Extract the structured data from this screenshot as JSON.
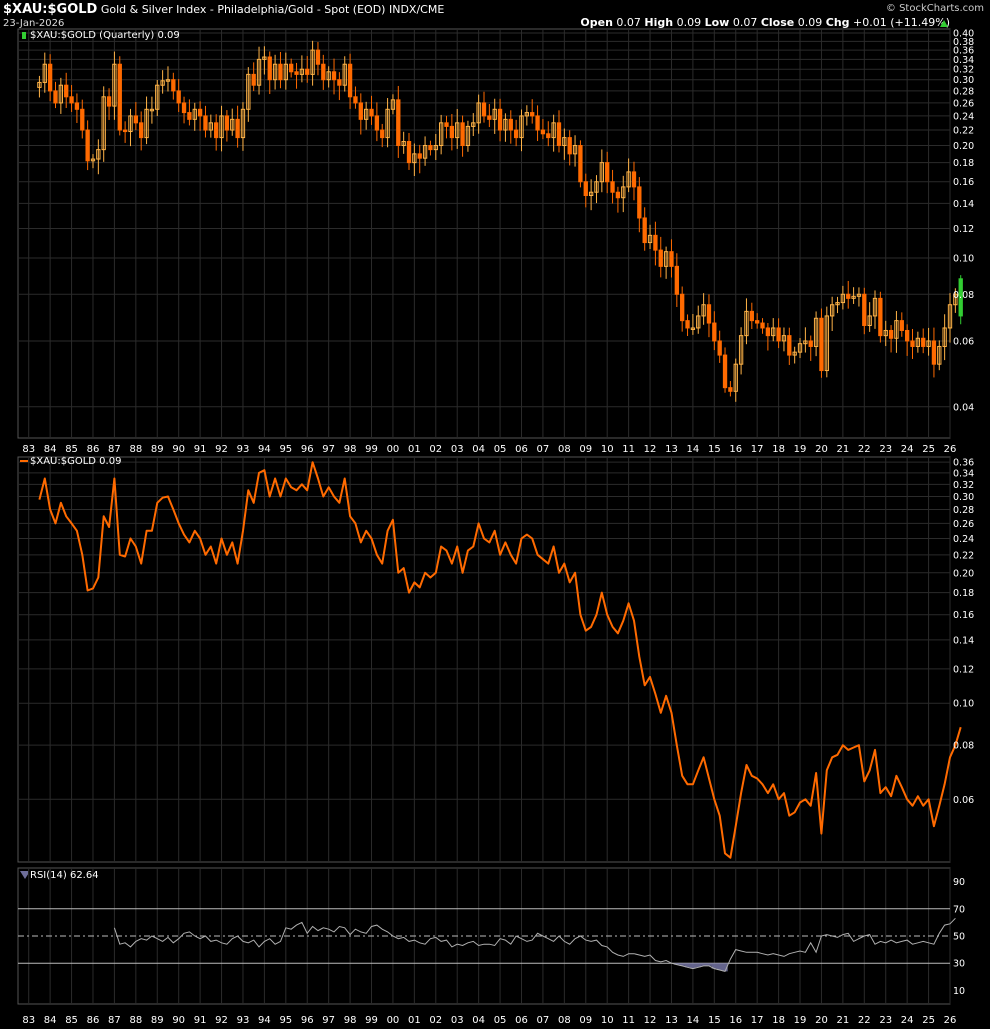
{
  "header": {
    "symbol": "$XAU:$GOLD",
    "description": "Gold & Silver Index - Philadelphia/Gold - Spot (EOD)",
    "exchange": "INDX/CME",
    "date": "23-Jan-2026",
    "brand": "© StockCharts.com",
    "open_label": "Open",
    "open": "0.07",
    "high_label": "High",
    "high": "0.09",
    "low_label": "Low",
    "low": "0.07",
    "close_label": "Close",
    "close": "0.09",
    "chg_label": "Chg",
    "chg": "+0.01 (+11.49%)",
    "up_icon": "triangle-up-icon"
  },
  "legends": {
    "candle": "$XAU:$GOLD (Quarterly) 0.09",
    "line": "$XAU:$GOLD 0.09",
    "rsi": "RSI(14) 62.64"
  },
  "colors": {
    "background": "#000000",
    "grid": "#2b2b2b",
    "candle_down": "#ff6a00",
    "candle_up": "#ffb347",
    "candle_last": "#32cd32",
    "line": "#ff6a00",
    "rsi_line": "#b0b0b0",
    "rsi_fill": "#6e6e9a"
  },
  "chart_data": [
    {
      "type": "candlestick",
      "title": "$XAU:$GOLD (Quarterly) 0.09",
      "x_tick_labels": [
        "83",
        "84",
        "85",
        "86",
        "87",
        "88",
        "89",
        "90",
        "91",
        "92",
        "93",
        "94",
        "95",
        "96",
        "97",
        "98",
        "99",
        "00",
        "01",
        "02",
        "03",
        "04",
        "05",
        "06",
        "07",
        "08",
        "09",
        "10",
        "11",
        "12",
        "13",
        "14",
        "15",
        "16",
        "17",
        "18",
        "19",
        "20",
        "21",
        "22",
        "23",
        "24",
        "25",
        "26"
      ],
      "y_scale": "log",
      "y_tick_labels": [
        "0.40",
        "0.38",
        "0.36",
        "0.34",
        "0.32",
        "0.30",
        "0.28",
        "0.26",
        "0.24",
        "0.22",
        "0.20",
        "0.18",
        "0.16",
        "0.14",
        "0.12",
        "0.10",
        "0.08",
        "0.06",
        "0.04"
      ],
      "y_range": [
        0.033,
        0.41
      ],
      "close_series": "shared_series.closes",
      "last_candle": {
        "open": 0.07,
        "high": 0.09,
        "low": 0.07,
        "close": 0.09
      }
    },
    {
      "type": "line",
      "title": "$XAU:$GOLD 0.09",
      "y_scale": "log",
      "y_tick_labels": [
        "0.36",
        "0.34",
        "0.32",
        "0.30",
        "0.28",
        "0.26",
        "0.24",
        "0.22",
        "0.20",
        "0.18",
        "0.16",
        "0.14",
        "0.12",
        "0.10",
        "0.08",
        "0.06"
      ],
      "y_range": [
        0.043,
        0.37
      ],
      "x_start": 1984.0,
      "x_step": 0.25,
      "values": [
        0.295,
        0.33,
        0.28,
        0.26,
        0.29,
        0.27,
        0.26,
        0.25,
        0.22,
        0.182,
        0.184,
        0.195,
        0.27,
        0.255,
        0.33,
        0.22,
        0.218,
        0.24,
        0.23,
        0.21,
        0.25,
        0.25,
        0.29,
        0.298,
        0.3,
        0.28,
        0.26,
        0.245,
        0.235,
        0.25,
        0.24,
        0.22,
        0.23,
        0.21,
        0.24,
        0.22,
        0.235,
        0.21,
        0.25,
        0.31,
        0.29,
        0.34,
        0.345,
        0.3,
        0.33,
        0.3,
        0.33,
        0.315,
        0.31,
        0.32,
        0.31,
        0.36,
        0.33,
        0.3,
        0.315,
        0.3,
        0.29,
        0.33,
        0.27,
        0.26,
        0.235,
        0.25,
        0.24,
        0.22,
        0.21,
        0.25,
        0.265,
        0.2,
        0.205,
        0.18,
        0.19,
        0.185,
        0.2,
        0.195,
        0.2,
        0.23,
        0.225,
        0.21,
        0.23,
        0.2,
        0.225,
        0.23,
        0.26,
        0.24,
        0.235,
        0.25,
        0.22,
        0.235,
        0.22,
        0.21,
        0.24,
        0.245,
        0.24,
        0.22,
        0.215,
        0.21,
        0.23,
        0.2,
        0.21,
        0.19,
        0.2,
        0.16,
        0.147,
        0.15,
        0.16,
        0.18,
        0.16,
        0.15,
        0.145,
        0.155,
        0.17,
        0.155,
        0.128,
        0.11,
        0.115,
        0.105,
        0.095,
        0.104,
        0.095,
        0.08,
        0.068,
        0.065,
        0.065,
        0.07,
        0.075,
        0.067,
        0.06,
        0.055,
        0.045,
        0.044,
        0.052,
        0.062,
        0.072,
        0.068,
        0.067,
        0.065,
        0.062,
        0.065,
        0.06,
        0.062,
        0.055,
        0.056,
        0.059,
        0.06,
        0.058,
        0.069,
        0.05,
        0.07,
        0.075,
        0.076,
        0.08,
        0.078,
        0.079,
        0.08,
        0.066,
        0.07,
        0.078,
        0.062,
        0.064,
        0.061,
        0.068,
        0.064,
        0.06,
        0.058,
        0.061,
        0.058,
        0.06,
        0.052,
        0.058,
        0.065,
        0.075,
        0.08,
        0.088
      ]
    },
    {
      "type": "line",
      "title": "RSI(14) 62.64",
      "y_tick_labels": [
        "90",
        "70",
        "50",
        "30",
        "10"
      ],
      "y_range": [
        0,
        100
      ],
      "reference_lines": [
        70,
        50,
        30
      ],
      "x_start": 1987.5,
      "x_step": 0.25,
      "values": [
        56,
        44,
        45,
        42,
        46,
        48,
        47,
        50,
        48,
        46,
        49,
        45,
        48,
        52,
        53,
        50,
        48,
        50,
        46,
        47,
        45,
        44,
        48,
        50,
        46,
        45,
        47,
        42,
        46,
        48,
        44,
        46,
        56,
        55,
        58,
        60,
        52,
        57,
        54,
        56,
        55,
        53,
        57,
        56,
        51,
        55,
        53,
        52,
        57,
        58,
        55,
        53,
        50,
        48,
        49,
        46,
        47,
        45,
        44,
        48,
        49,
        46,
        47,
        42,
        44,
        43,
        45,
        46,
        43,
        44,
        44,
        43,
        48,
        47,
        44,
        50,
        48,
        46,
        47,
        52,
        50,
        48,
        46,
        50,
        46,
        44,
        48,
        50,
        47,
        46,
        47,
        43,
        42,
        38,
        36,
        35,
        37,
        37,
        36,
        35,
        36,
        32,
        31,
        32,
        30,
        29,
        28,
        27,
        26,
        27,
        28,
        28,
        26,
        25,
        24,
        33,
        40,
        39,
        38,
        38,
        38,
        37,
        36,
        37,
        36,
        35,
        37,
        38,
        39,
        38,
        45,
        38,
        50,
        51,
        50,
        49,
        51,
        52,
        46,
        48,
        50,
        51,
        44,
        46,
        45,
        47,
        45,
        46,
        47,
        44,
        45,
        46,
        45,
        44,
        52,
        58,
        59,
        63
      ]
    }
  ]
}
